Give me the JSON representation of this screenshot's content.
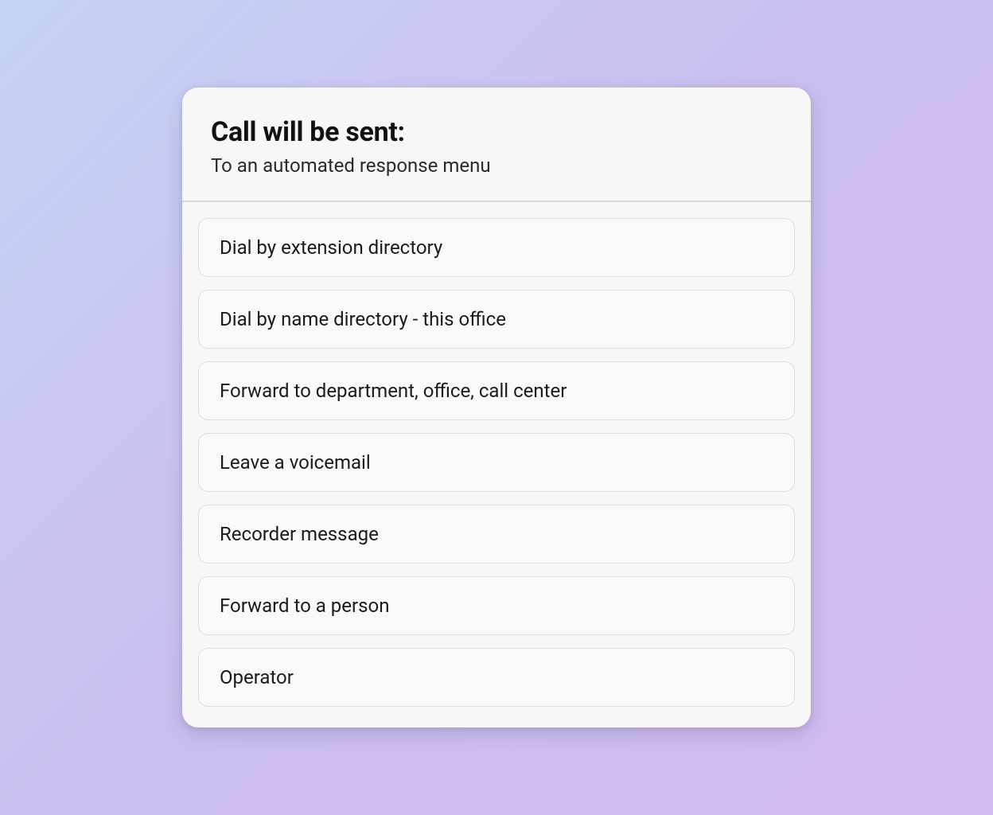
{
  "header": {
    "title": "Call will be sent:",
    "subtitle": "To an automated response menu"
  },
  "options": [
    {
      "label": "Dial by extension directory"
    },
    {
      "label": "Dial by name directory - this office"
    },
    {
      "label": "Forward to department, office, call center"
    },
    {
      "label": "Leave a voicemail"
    },
    {
      "label": "Recorder message"
    },
    {
      "label": "Forward to a person"
    },
    {
      "label": "Operator"
    }
  ]
}
